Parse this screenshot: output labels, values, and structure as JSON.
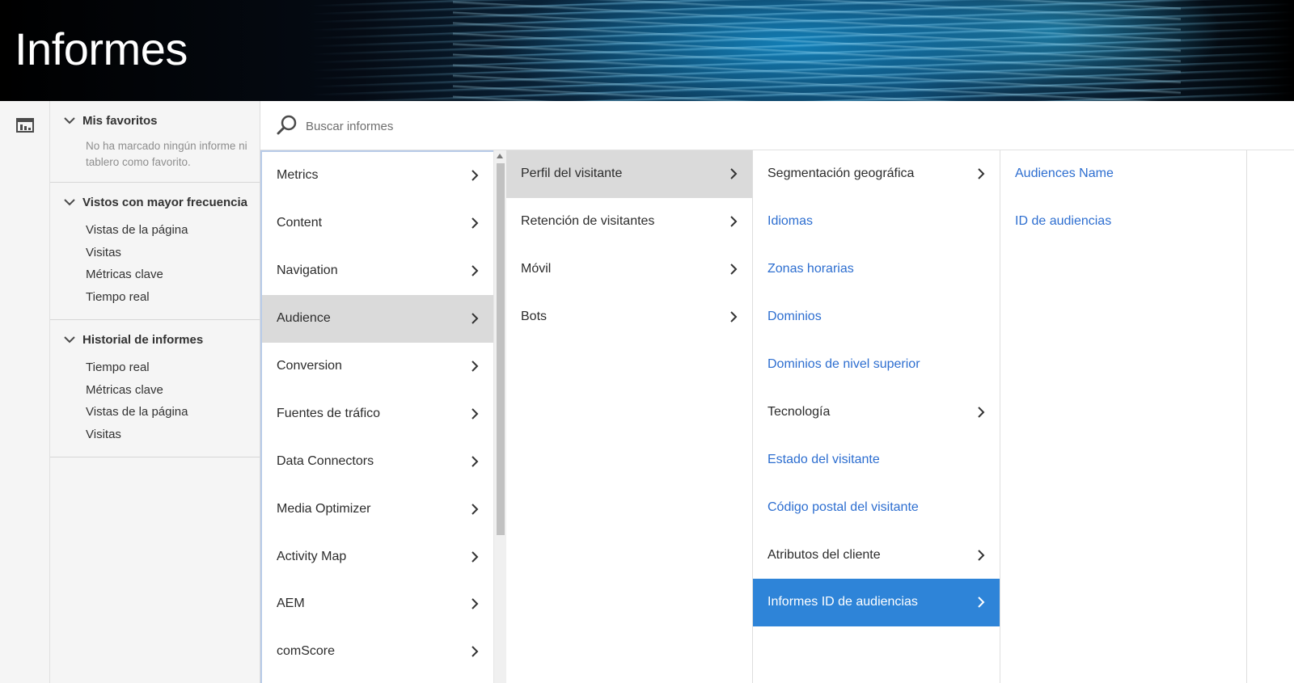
{
  "header": {
    "title": "Informes"
  },
  "rail": {
    "icon": "report-list-icon"
  },
  "sidebar": {
    "sections": [
      {
        "title": "Mis favoritos",
        "empty_text": "No ha marcado ningún informe ni tablero como favorito.",
        "items": []
      },
      {
        "title": "Vistos con mayor frecuencia",
        "items": [
          "Vistas de la página",
          "Visitas",
          "Métricas clave",
          "Tiempo real"
        ]
      },
      {
        "title": "Historial de informes",
        "items": [
          "Tiempo real",
          "Métricas clave",
          "Vistas de la página",
          "Visitas"
        ]
      }
    ]
  },
  "search": {
    "placeholder": "Buscar informes",
    "value": ""
  },
  "columns": {
    "col1": [
      {
        "label": "Metrics",
        "has_children": true
      },
      {
        "label": "Content",
        "has_children": true
      },
      {
        "label": "Navigation",
        "has_children": true
      },
      {
        "label": "Audience",
        "has_children": true,
        "selected": true
      },
      {
        "label": "Conversion",
        "has_children": true
      },
      {
        "label": "Fuentes de tráfico",
        "has_children": true
      },
      {
        "label": "Data Connectors",
        "has_children": true
      },
      {
        "label": "Media Optimizer",
        "has_children": true
      },
      {
        "label": "Activity Map",
        "has_children": true
      },
      {
        "label": "AEM",
        "has_children": true
      },
      {
        "label": "comScore",
        "has_children": true
      }
    ],
    "col2": [
      {
        "label": "Perfil del visitante",
        "has_children": true,
        "selected": true
      },
      {
        "label": "Retención de visitantes",
        "has_children": true
      },
      {
        "label": "Móvil",
        "has_children": true
      },
      {
        "label": "Bots",
        "has_children": true
      }
    ],
    "col3": [
      {
        "label": "Segmentación geográfica",
        "has_children": true
      },
      {
        "label": "Idiomas",
        "link": true
      },
      {
        "label": "Zonas horarias",
        "link": true
      },
      {
        "label": "Dominios",
        "link": true
      },
      {
        "label": "Dominios de nivel superior",
        "link": true
      },
      {
        "label": "Tecnología",
        "has_children": true
      },
      {
        "label": "Estado del visitante",
        "link": true
      },
      {
        "label": "Código postal del visitante",
        "link": true
      },
      {
        "label": "Atributos del cliente",
        "has_children": true
      },
      {
        "label": "Informes ID de audiencias",
        "has_children": true,
        "active": true
      }
    ],
    "col4": [
      {
        "label": "Audiences Name",
        "link": true
      },
      {
        "label": "ID de audiencias",
        "link": true
      }
    ]
  },
  "colors": {
    "link": "#2d6ed0",
    "active_bg": "#2e84d8",
    "selected_bg": "#dadada",
    "sidebar_bg": "#f5f5f5"
  }
}
